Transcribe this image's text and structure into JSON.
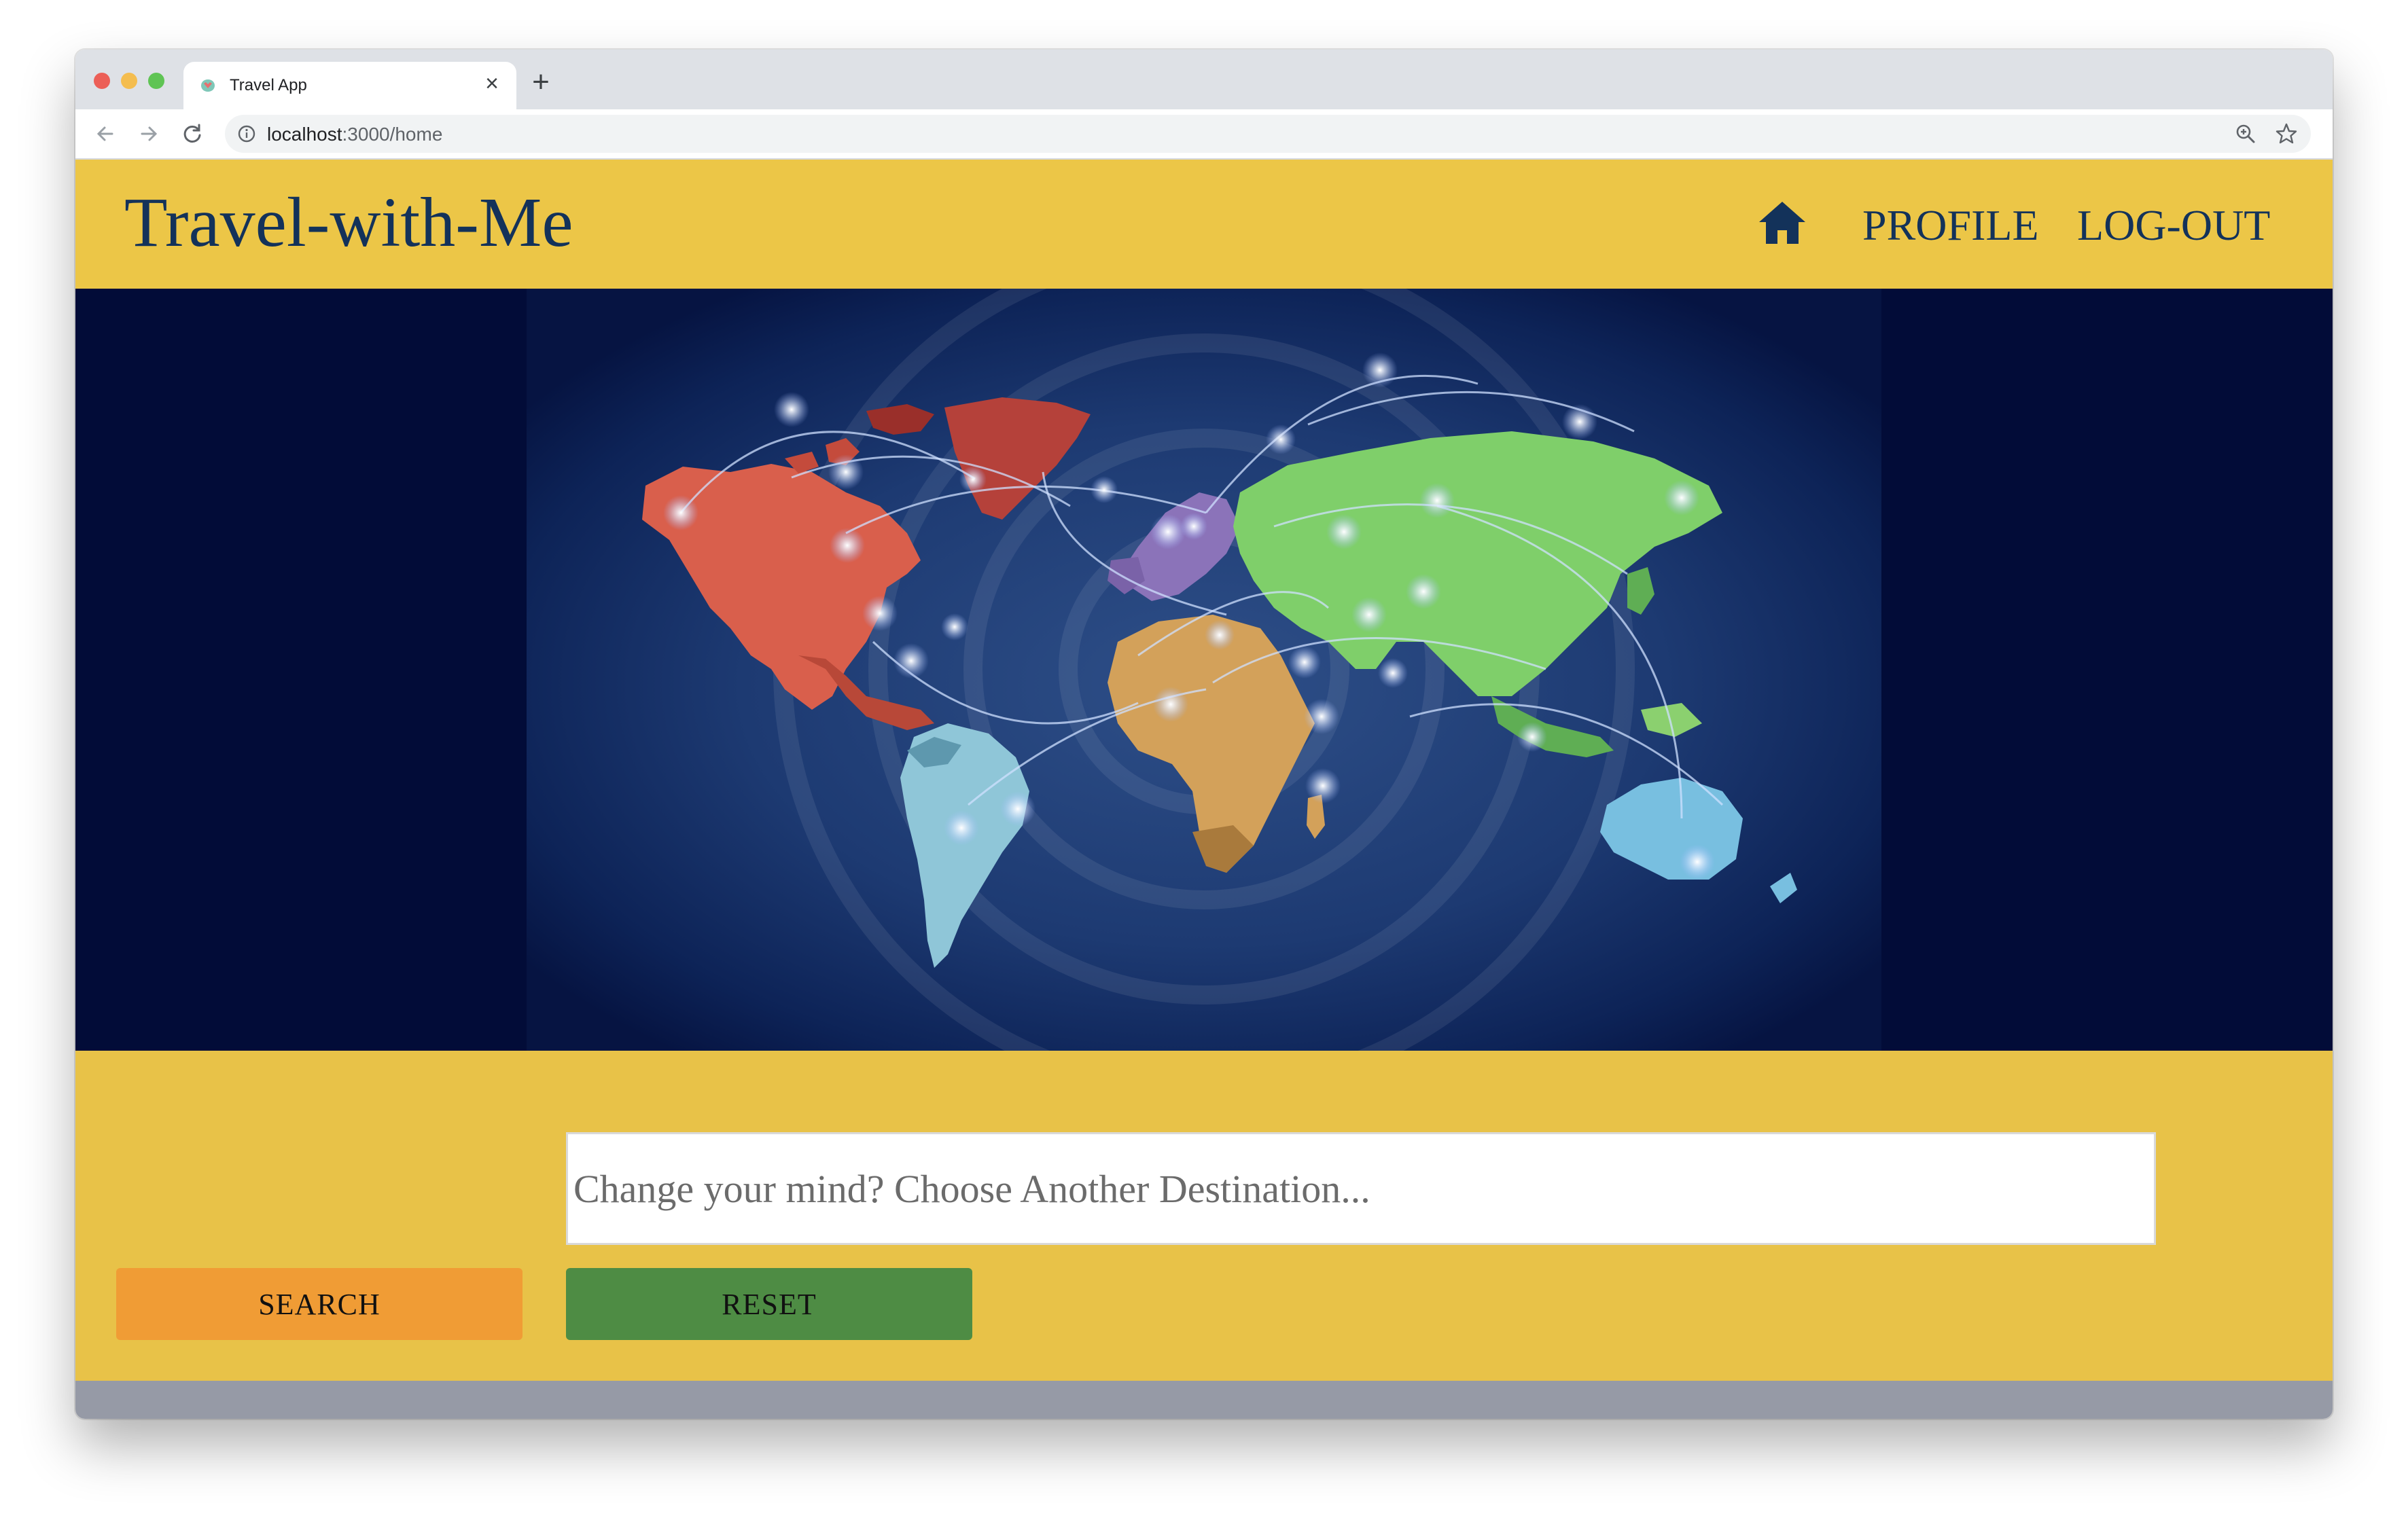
{
  "browser": {
    "tab_title": "Travel App",
    "url_host": "localhost",
    "url_path": ":3000/home",
    "close_glyph": "×",
    "new_tab_glyph": "+",
    "icons": [
      "back-arrow-icon",
      "forward-arrow-icon",
      "reload-icon",
      "info-icon",
      "zoom-icon",
      "star-icon",
      "globe-favicon"
    ]
  },
  "header": {
    "brand": "Travel-with-Me",
    "nav": {
      "home_icon": "home-icon",
      "profile": "PROFILE",
      "logout": "LOG-OUT"
    },
    "background": "#ecc647",
    "text_color": "#13325a"
  },
  "hero": {
    "image": "world-map-with-flight-routes",
    "background": "#020c38"
  },
  "search": {
    "placeholder": "Change your mind? Choose Another Destination...",
    "value": "",
    "search_label": "SEARCH",
    "reset_label": "RESET",
    "search_color": "#f09c35",
    "reset_color": "#4e8c44",
    "background": "#e8c248"
  },
  "footer": {
    "color": "#969aa6"
  }
}
